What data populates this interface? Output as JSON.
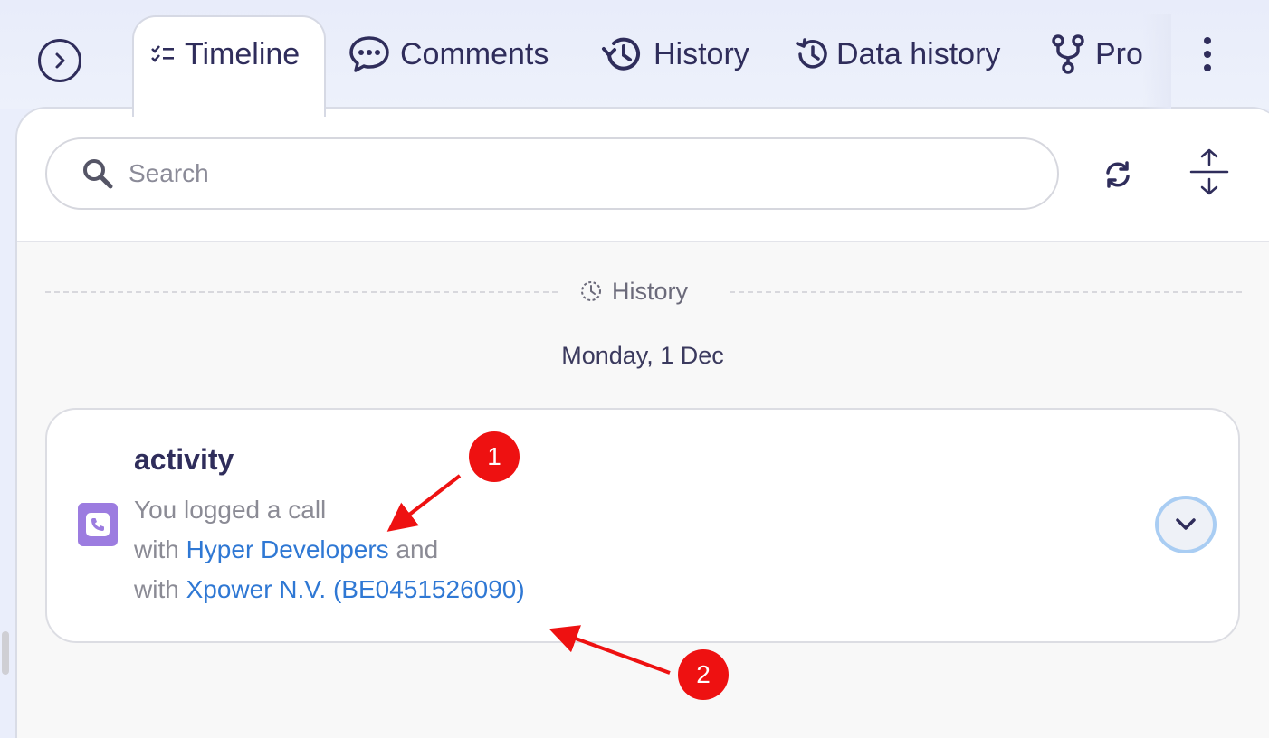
{
  "tabs": {
    "timeline": "Timeline",
    "comments": "Comments",
    "history": "History",
    "data_history": "Data history",
    "processes": "Pro"
  },
  "search": {
    "placeholder": "Search"
  },
  "feed": {
    "section_label": "History",
    "date": "Monday, 1 Dec",
    "item": {
      "title": "activity",
      "line1": "You logged a call",
      "with1_prefix": "with ",
      "with1_link": "Hyper Developers",
      "with1_suffix": " and",
      "with2_prefix": "with ",
      "with2_link": "Xpower N.V. (BE0451526090)"
    }
  },
  "annotations": [
    "1",
    "2"
  ],
  "colors": {
    "text_dark": "#2f2d5b",
    "link": "#2f78d4",
    "call_icon_bg": "#9c7ce0",
    "annotation": "#ee1111",
    "chevron_ring": "#a9cdf3"
  },
  "icons": [
    "chevron-right-circle-icon",
    "checklist-icon",
    "chat-bubble-icon",
    "history-clock-icon",
    "data-history-icon",
    "fork-icon",
    "more-vertical-icon",
    "search-icon",
    "refresh-icon",
    "expand-vertical-icon",
    "clock-dashed-icon",
    "phone-icon",
    "chevron-down-icon"
  ]
}
